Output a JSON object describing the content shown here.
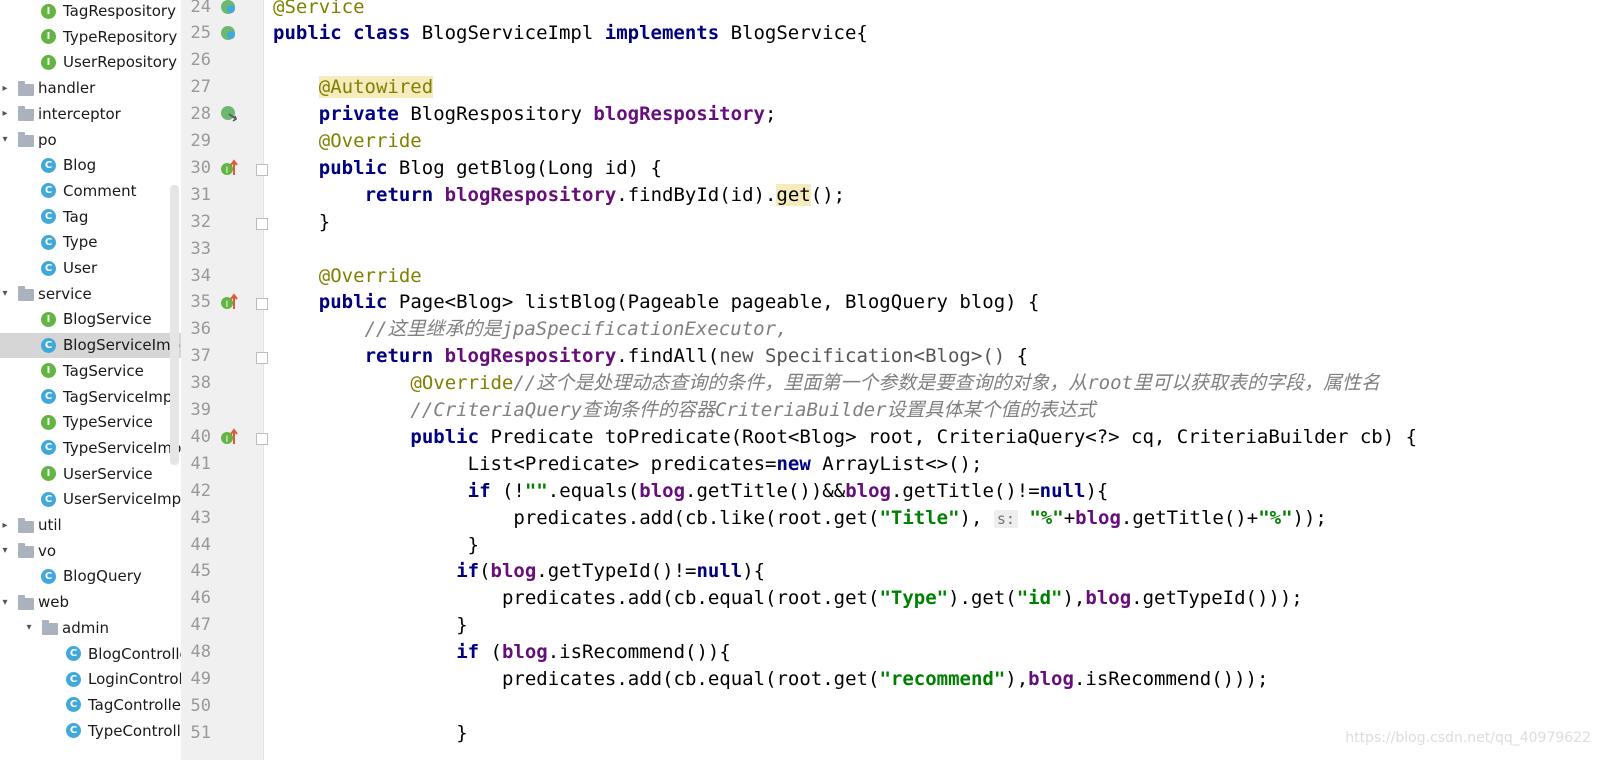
{
  "sidebar": {
    "tree": [
      {
        "label": "TagRespository",
        "kind": "interface",
        "indent": 1
      },
      {
        "label": "TypeRepository",
        "kind": "interface",
        "indent": 1
      },
      {
        "label": "UserRepository",
        "kind": "interface",
        "indent": 1
      },
      {
        "label": "handler",
        "kind": "folder",
        "indent": 0,
        "expanded": false
      },
      {
        "label": "interceptor",
        "kind": "folder",
        "indent": 0,
        "expanded": false
      },
      {
        "label": "po",
        "kind": "folder",
        "indent": 0,
        "expanded": true
      },
      {
        "label": "Blog",
        "kind": "class",
        "indent": 1
      },
      {
        "label": "Comment",
        "kind": "class",
        "indent": 1
      },
      {
        "label": "Tag",
        "kind": "class",
        "indent": 1
      },
      {
        "label": "Type",
        "kind": "class",
        "indent": 1
      },
      {
        "label": "User",
        "kind": "class",
        "indent": 1
      },
      {
        "label": "service",
        "kind": "folder",
        "indent": 0,
        "expanded": true
      },
      {
        "label": "BlogService",
        "kind": "interface",
        "indent": 1
      },
      {
        "label": "BlogServiceImpl",
        "kind": "class",
        "indent": 1,
        "selected": true
      },
      {
        "label": "TagService",
        "kind": "interface",
        "indent": 1
      },
      {
        "label": "TagServiceImpl",
        "kind": "class",
        "indent": 1
      },
      {
        "label": "TypeService",
        "kind": "interface",
        "indent": 1
      },
      {
        "label": "TypeServiceImpl",
        "kind": "class",
        "indent": 1
      },
      {
        "label": "UserService",
        "kind": "interface",
        "indent": 1
      },
      {
        "label": "UserServiceImpl",
        "kind": "class",
        "indent": 1
      },
      {
        "label": "util",
        "kind": "folder",
        "indent": 0,
        "expanded": false
      },
      {
        "label": "vo",
        "kind": "folder",
        "indent": 0,
        "expanded": true
      },
      {
        "label": "BlogQuery",
        "kind": "class",
        "indent": 1
      },
      {
        "label": "web",
        "kind": "folder",
        "indent": 0,
        "expanded": true
      },
      {
        "label": "admin",
        "kind": "folder",
        "indent": 1,
        "expanded": true
      },
      {
        "label": "BlogController",
        "kind": "class",
        "indent": 2
      },
      {
        "label": "LoginController",
        "kind": "class",
        "indent": 2
      },
      {
        "label": "TagController",
        "kind": "class",
        "indent": 2
      },
      {
        "label": "TypeController",
        "kind": "class",
        "indent": 2
      }
    ]
  },
  "gutter": {
    "line_numbers": [
      "24",
      "25",
      "26",
      "27",
      "28",
      "29",
      "30",
      "31",
      "32",
      "33",
      "34",
      "35",
      "36",
      "37",
      "38",
      "39",
      "40",
      "41",
      "42",
      "43",
      "44",
      "45",
      "46",
      "47",
      "48",
      "49",
      "50",
      "51"
    ]
  },
  "editor": {
    "lines": [
      {
        "indent": 0,
        "tokens": [
          [
            "@Service",
            "ann"
          ]
        ]
      },
      {
        "indent": 0,
        "tokens": [
          [
            "public ",
            "kw"
          ],
          [
            "class ",
            "kw"
          ],
          [
            "BlogServiceImpl ",
            ""
          ],
          [
            "implements ",
            "kw"
          ],
          [
            "BlogService{",
            ""
          ]
        ]
      },
      {
        "indent": 0,
        "tokens": []
      },
      {
        "indent": 4,
        "tokens": [
          [
            "@Autowired",
            "ann-hl"
          ]
        ]
      },
      {
        "indent": 4,
        "tokens": [
          [
            "private ",
            "kw"
          ],
          [
            "BlogRespository ",
            ""
          ],
          [
            "blogRespository",
            "fld"
          ],
          [
            ";",
            ""
          ]
        ]
      },
      {
        "indent": 4,
        "tokens": [
          [
            "@Override",
            "ann"
          ]
        ]
      },
      {
        "indent": 4,
        "tokens": [
          [
            "public ",
            "kw"
          ],
          [
            "Blog getBlog(Long id) {",
            ""
          ]
        ]
      },
      {
        "indent": 8,
        "tokens": [
          [
            "return ",
            "kw"
          ],
          [
            "blogRespository",
            "fld"
          ],
          [
            ".findById(id).",
            ""
          ],
          [
            "get",
            "hl"
          ],
          [
            "();",
            ""
          ]
        ]
      },
      {
        "indent": 4,
        "tokens": [
          [
            "}",
            ""
          ]
        ]
      },
      {
        "indent": 0,
        "tokens": []
      },
      {
        "indent": 4,
        "tokens": [
          [
            "@Override",
            "ann"
          ]
        ]
      },
      {
        "indent": 4,
        "tokens": [
          [
            "public ",
            "kw"
          ],
          [
            "Page<Blog> listBlog(Pageable pageable, BlogQuery blog) {",
            ""
          ]
        ]
      },
      {
        "indent": 8,
        "tokens": [
          [
            "//这里继承的是jpaSpecificationExecutor,",
            "cmt"
          ]
        ]
      },
      {
        "indent": 8,
        "tokens": [
          [
            "return ",
            "kw"
          ],
          [
            "blogRespository",
            "fld"
          ],
          [
            ".findAll(",
            ""
          ],
          [
            "new Specification<Blog>() ",
            "gray"
          ],
          [
            "{",
            ""
          ]
        ]
      },
      {
        "indent": 12,
        "tokens": [
          [
            "@Override",
            "ann"
          ],
          [
            "//这个是处理动态查询的条件，里面第一个参数是要查询的对象，从root里可以获取表的字段，属性名",
            "cmt"
          ]
        ]
      },
      {
        "indent": 12,
        "tokens": [
          [
            "//CriteriaQuery查询条件的容器CriteriaBuilder设置具体某个值的表达式",
            "cmt"
          ]
        ]
      },
      {
        "indent": 12,
        "tokens": [
          [
            "public ",
            "kw"
          ],
          [
            "Predicate toPredicate(Root<Blog> root, CriteriaQuery<?> cq, CriteriaBuilder cb) {",
            ""
          ]
        ]
      },
      {
        "indent": 16,
        "tokens": [
          [
            " List<Predicate> predicates=",
            ""
          ],
          [
            "new ",
            "kw"
          ],
          [
            "ArrayList<>();",
            ""
          ]
        ]
      },
      {
        "indent": 16,
        "tokens": [
          [
            " ",
            ""
          ],
          [
            "if ",
            "kw"
          ],
          [
            "(!",
            ""
          ],
          [
            "\"\"",
            "str"
          ],
          [
            ".equals(",
            ""
          ],
          [
            "blog",
            "fld"
          ],
          [
            ".getTitle())&&",
            ""
          ],
          [
            "blog",
            "fld"
          ],
          [
            ".getTitle()!=",
            ""
          ],
          [
            "null",
            "kw"
          ],
          [
            "){",
            ""
          ]
        ]
      },
      {
        "indent": 16,
        "tokens": [
          [
            "     predicates.add(cb.like(root.get(",
            ""
          ],
          [
            "\"Title\"",
            "str"
          ],
          [
            "), ",
            ""
          ],
          [
            "s:",
            "hint"
          ],
          [
            " ",
            ""
          ],
          [
            "\"%\"",
            "str"
          ],
          [
            "+",
            ""
          ],
          [
            "blog",
            "fld"
          ],
          [
            ".getTitle()+",
            ""
          ],
          [
            "\"%\"",
            "str"
          ],
          [
            "));",
            ""
          ]
        ]
      },
      {
        "indent": 16,
        "tokens": [
          [
            " }",
            ""
          ]
        ]
      },
      {
        "indent": 16,
        "tokens": [
          [
            "if",
            "kw"
          ],
          [
            "(",
            ""
          ],
          [
            "blog",
            "fld"
          ],
          [
            ".getTypeId()!=",
            ""
          ],
          [
            "null",
            "kw"
          ],
          [
            "){",
            ""
          ]
        ]
      },
      {
        "indent": 16,
        "tokens": [
          [
            "    predicates.add(cb.equal(root.get(",
            ""
          ],
          [
            "\"Type\"",
            "str"
          ],
          [
            ").get(",
            ""
          ],
          [
            "\"id\"",
            "str"
          ],
          [
            "),",
            ""
          ],
          [
            "blog",
            "fld"
          ],
          [
            ".getTypeId()));",
            ""
          ]
        ]
      },
      {
        "indent": 16,
        "tokens": [
          [
            "}",
            ""
          ]
        ]
      },
      {
        "indent": 16,
        "tokens": [
          [
            "if ",
            "kw"
          ],
          [
            "(",
            ""
          ],
          [
            "blog",
            "fld"
          ],
          [
            ".isRecommend()){",
            ""
          ]
        ]
      },
      {
        "indent": 16,
        "tokens": [
          [
            "    predicates.add(cb.equal(root.get(",
            ""
          ],
          [
            "\"recommend\"",
            "str"
          ],
          [
            "),",
            ""
          ],
          [
            "blog",
            "fld"
          ],
          [
            ".isRecommend()));",
            ""
          ]
        ]
      },
      {
        "indent": 0,
        "tokens": []
      },
      {
        "indent": 16,
        "tokens": [
          [
            "}",
            ""
          ]
        ]
      }
    ]
  },
  "watermark": "https://blog.csdn.net/qq_40979622"
}
